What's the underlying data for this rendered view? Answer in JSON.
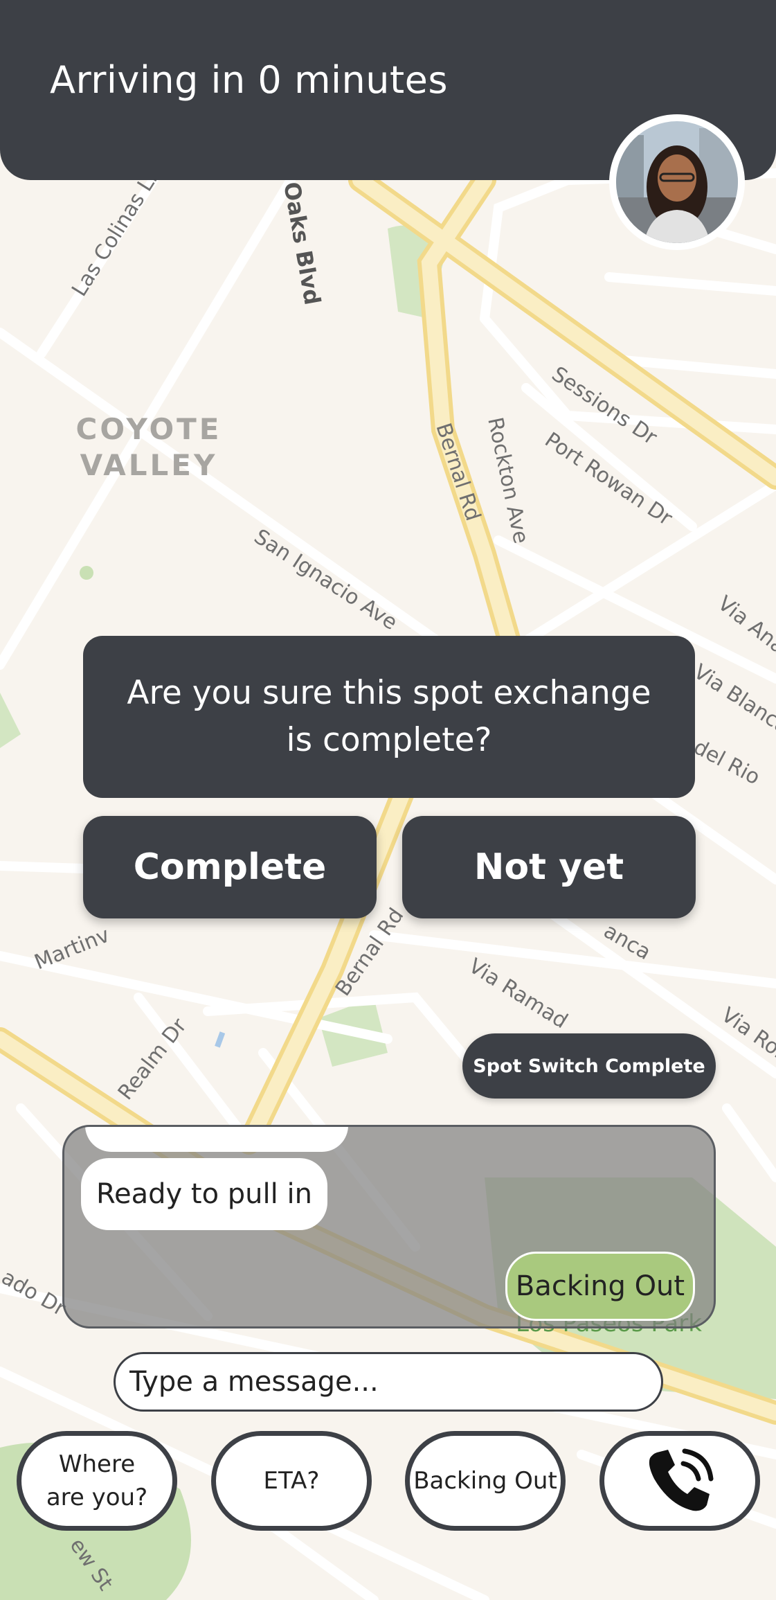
{
  "header": {
    "title": "Arriving in 0 minutes"
  },
  "map": {
    "area_label_line1": "COYOTE",
    "area_label_line2": "VALLEY",
    "streets": {
      "las_colinas": "Las Colinas Ln",
      "oaks_blvd": "Oaks Blvd",
      "sessions": "Sessions Dr",
      "port_rowan": "Port Rowan Dr",
      "bernal_upper": "Bernal Rd",
      "rockton": "Rockton Ave",
      "san_ignacio": "San Ignacio Ave",
      "via_ana": "Via Ana",
      "via_blanca": "Via Blanca",
      "del_rio": "del Rio",
      "martin": "Martinv",
      "bernal_lower": "Bernal Rd",
      "via_ramada": "Via Ramad",
      "realm": "Realm Dr",
      "via_ron": "Via Ron",
      "ado": "ado Dr",
      "lew": "ew St",
      "anca": "anca",
      "park": "Los Paseos Park"
    }
  },
  "dialog": {
    "message": "Are you sure this spot exchange is complete?",
    "complete_label": "Complete",
    "not_yet_label": "Not yet"
  },
  "spot_switch": {
    "label": "Spot Switch Complete"
  },
  "chat": {
    "messages": [
      {
        "side": "left",
        "text": "Ready to pull in"
      },
      {
        "side": "right",
        "text": "Backing Out"
      }
    ]
  },
  "composer": {
    "placeholder": "Type a message..."
  },
  "quick_replies": [
    {
      "label_line1": "Where",
      "label_line2": "are you?"
    },
    {
      "label": "ETA?"
    },
    {
      "label": "Backing Out"
    }
  ],
  "call_button": {
    "icon": "phone-icon"
  },
  "colors": {
    "dark": "#3d4046",
    "map_bg": "#f8f4ee",
    "road_major": "#f7e3a3",
    "park_green": "#c9e0b4",
    "bubble_green": "#a9c97e"
  }
}
